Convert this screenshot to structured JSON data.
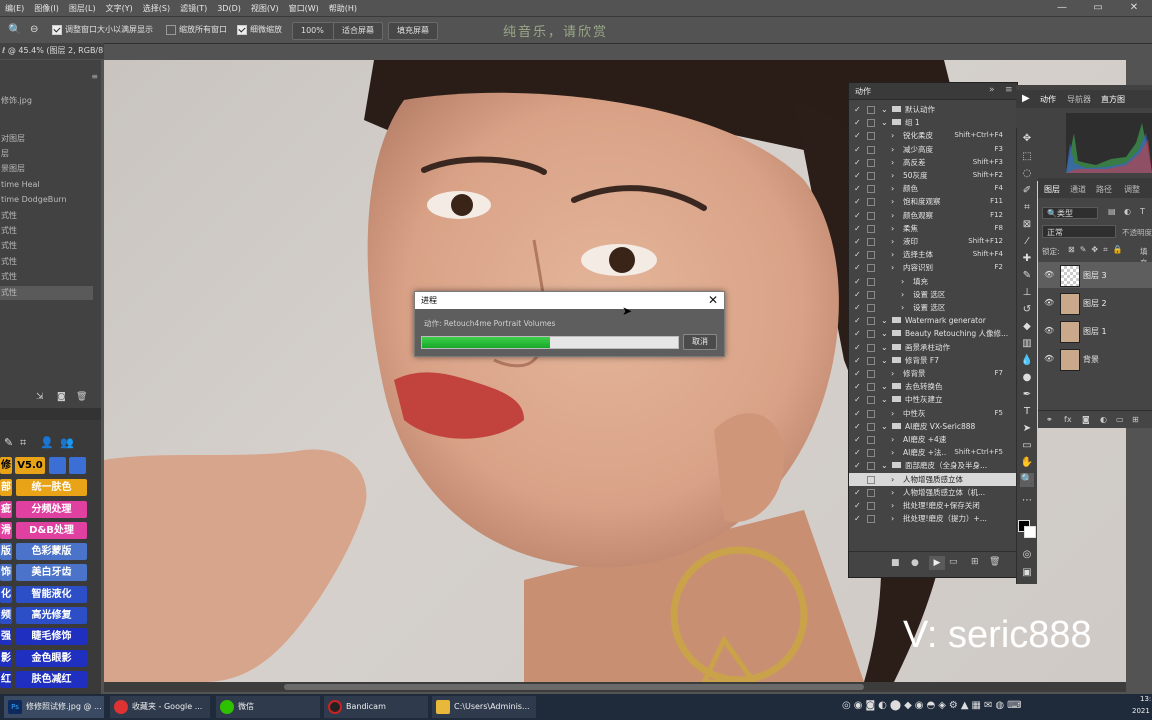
{
  "menubar": {
    "items": [
      "编(E)",
      "图像(I)",
      "图层(L)",
      "文字(Y)",
      "选择(S)",
      "滤镜(T)",
      "3D(D)",
      "视图(V)",
      "窗口(W)",
      "帮助(H)"
    ]
  },
  "options": {
    "resize_windows": "调整窗口大小以满屏显示",
    "zoom_all": "缩放所有窗口",
    "scrubby_zoom": "细微缩放",
    "zoom_value": "100%",
    "fit_screen": "适合屏幕",
    "fill_screen": "填充屏幕",
    "overlay_text": "纯音乐，请欣赏"
  },
  "doc_tab": "ℓ @ 45.4% (图层 2, RGB/8) *",
  "left_panel": {
    "rows": [
      "修饰.jpg",
      "对图层",
      "层",
      "景图层",
      "time Heal",
      "time DodgeBurn",
      "式性",
      "式性",
      "式性",
      "式性",
      "式性",
      "式性"
    ]
  },
  "plugin_buttons": [
    {
      "left": "修",
      "right": "V5.0"
    },
    {
      "left": "部",
      "right": "统一肤色"
    },
    {
      "left": "疵",
      "right": "分频处理"
    },
    {
      "left": "滑",
      "right": "D&B处理"
    },
    {
      "left": "版",
      "right": "色彩蒙版"
    },
    {
      "left": "饰",
      "right": "美白牙齿"
    },
    {
      "left": "化",
      "right": "智能液化"
    },
    {
      "left": "频",
      "right": "高光修复"
    },
    {
      "left": "强",
      "right": "睫毛修饰"
    },
    {
      "left": "影",
      "right": "金色眼影"
    },
    {
      "left": "红",
      "right": "肤色减红"
    }
  ],
  "actions_panel": {
    "title": "动作",
    "rows": [
      {
        "name": "默认动作",
        "shortcut": "",
        "indent": 0,
        "folder": true
      },
      {
        "name": "组 1",
        "shortcut": "",
        "indent": 0,
        "folder": true
      },
      {
        "name": "锐化柔皮",
        "shortcut": "Shift+Ctrl+F4",
        "indent": 1
      },
      {
        "name": "减少高度",
        "shortcut": "F3",
        "indent": 1
      },
      {
        "name": "高反差",
        "shortcut": "Shift+F3",
        "indent": 1
      },
      {
        "name": "50灰度",
        "shortcut": "Shift+F2",
        "indent": 1
      },
      {
        "name": "颜色",
        "shortcut": "F4",
        "indent": 1
      },
      {
        "name": "饱和度观察",
        "shortcut": "F11",
        "indent": 1
      },
      {
        "name": "颜色观察",
        "shortcut": "F12",
        "indent": 1
      },
      {
        "name": "柔焦",
        "shortcut": "F8",
        "indent": 1
      },
      {
        "name": "液印",
        "shortcut": "Shift+F12",
        "indent": 1
      },
      {
        "name": "选择主体",
        "shortcut": "Shift+F4",
        "indent": 1
      },
      {
        "name": "内容识别",
        "shortcut": "F2",
        "indent": 1
      },
      {
        "name": "填充",
        "shortcut": "",
        "indent": 2
      },
      {
        "name": "设置 选区",
        "shortcut": "",
        "indent": 2
      },
      {
        "name": "设置 选区",
        "shortcut": "",
        "indent": 2
      },
      {
        "name": "Watermark generator",
        "shortcut": "",
        "indent": 0,
        "folder": true
      },
      {
        "name": "Beauty Retouching 人像修...",
        "shortcut": "",
        "indent": 0,
        "folder": true
      },
      {
        "name": "画景承柱动作",
        "shortcut": "",
        "indent": 0,
        "folder": true
      },
      {
        "name": "修背景 F7",
        "shortcut": "",
        "indent": 0,
        "folder": true
      },
      {
        "name": "修背景",
        "shortcut": "F7",
        "indent": 1
      },
      {
        "name": "去色转换色",
        "shortcut": "",
        "indent": 0,
        "folder": true
      },
      {
        "name": "中性灰建立",
        "shortcut": "",
        "indent": 0,
        "folder": true
      },
      {
        "name": "中性灰",
        "shortcut": "F5",
        "indent": 1
      },
      {
        "name": "AI磨皮 VX-Seric888",
        "shortcut": "",
        "indent": 0,
        "folder": true
      },
      {
        "name": "AI磨皮 +4速",
        "shortcut": "",
        "indent": 1
      },
      {
        "name": "AI磨皮 +法...",
        "shortcut": "Shift+Ctrl+F5",
        "indent": 1
      },
      {
        "name": "面部磨皮（全身及半身...",
        "shortcut": "",
        "indent": 0,
        "folder": true
      },
      {
        "name": "人物增强质感立体",
        "shortcut": "",
        "indent": 1,
        "highlight": true
      },
      {
        "name": "人物增强质感立体（机...",
        "shortcut": "",
        "indent": 1
      },
      {
        "name": "批处理!磨皮+保存关闭",
        "shortcut": "",
        "indent": 1
      },
      {
        "name": "批处理!磨皮（提力）+...",
        "shortcut": "",
        "indent": 1
      }
    ]
  },
  "right_panel": {
    "tabs": [
      "动作",
      "导航器",
      "直方图"
    ],
    "layer_tabs": [
      "图层",
      "通道",
      "路径",
      "调整"
    ],
    "kind_label": "类型",
    "blend_mode": "正常",
    "opacity_label": "不透明度",
    "lock_label": "锁定:",
    "fill_label": "填充",
    "layers": [
      "图层 3",
      "图层 2",
      "图层 1",
      "背景"
    ]
  },
  "dialog": {
    "title": "进程",
    "message": "动作: Retouch4me Portrait Volumes",
    "progress_fraction": 0.5,
    "cancel": "取消"
  },
  "overlay_signature": "V: seric888",
  "taskbar": {
    "items": [
      "修修照试修.jpg @ ...",
      "收藏夹 - Google ...",
      "微信",
      "Bandicam",
      "C:\\Users\\Adminis..."
    ],
    "clock_top": "13:",
    "clock_bottom": "2021"
  }
}
